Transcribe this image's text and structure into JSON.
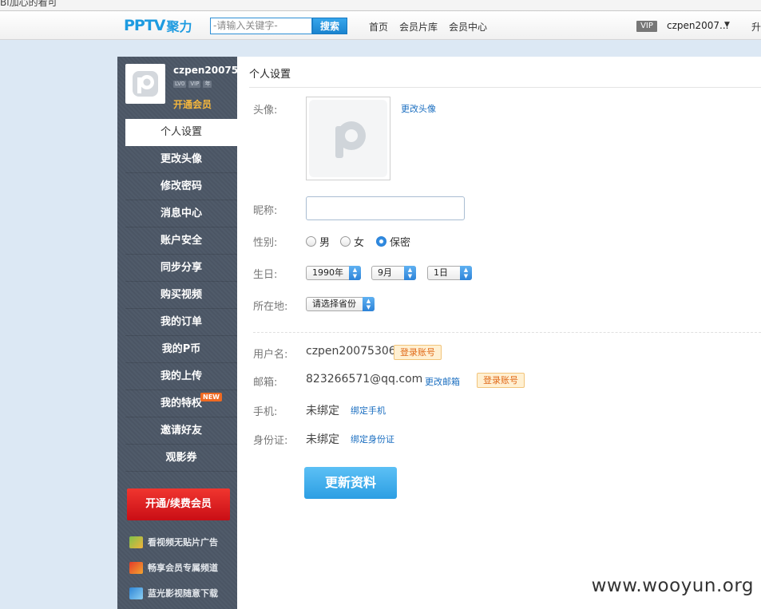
{
  "top_strip": {
    "text": "Bi加心的看可"
  },
  "header": {
    "logo_latin": "PPTV",
    "logo_cn": "聚力",
    "search_placeholder": "-请输入关键字-",
    "search_button": "搜索",
    "nav": [
      "首页",
      "会员片库",
      "会员中心"
    ],
    "vip_badge": "VIP",
    "username": "czpen2007...",
    "caret": "▼",
    "extra": "升"
  },
  "sidebar": {
    "profile_name": "czpen20075...",
    "level_tags": [
      "LV0",
      "VIP",
      "年"
    ],
    "open_member": "开通会员",
    "menu": [
      "个人设置",
      "更改头像",
      "修改密码",
      "消息中心",
      "账户安全",
      "同步分享",
      "购买视频",
      "我的订单",
      "我的P币",
      "我的上传",
      "我的特权",
      "邀请好友",
      "观影券"
    ],
    "new_badge": "NEW",
    "renew_button": "开通/续费会员",
    "perks": [
      "看视频无贴片广告",
      "畅享会员专属频道",
      "蓝光影视随意下载"
    ]
  },
  "main": {
    "title": "个人设置",
    "avatar_label": "头像:",
    "change_avatar": "更改头像",
    "nickname_label": "昵称:",
    "nickname_value": "",
    "gender_label": "性别:",
    "gender_options": [
      "男",
      "女",
      "保密"
    ],
    "gender_selected": "保密",
    "birthday_label": "生日:",
    "birthday_year": "1990年",
    "birthday_month": "9月",
    "birthday_day": "1日",
    "location_label": "所在地:",
    "location_value": "请选择省份",
    "username_label": "用户名:",
    "username_value": "czpen20075306",
    "login_account": "登录账号",
    "email_label": "邮箱:",
    "email_value": "823266571@qq.com",
    "change_email": "更改邮箱",
    "phone_label": "手机:",
    "phone_value": "未绑定",
    "bind_phone": "绑定手机",
    "id_label": "身份证:",
    "id_value": "未绑定",
    "bind_id": "绑定身份证",
    "update_button": "更新资料"
  },
  "watermark": "www.wooyun.org",
  "colors": {
    "brand_blue": "#1e9be0",
    "sidebar_bg": "#4c5766",
    "accent_red": "#d8161b",
    "link_blue": "#1a6ec0"
  }
}
